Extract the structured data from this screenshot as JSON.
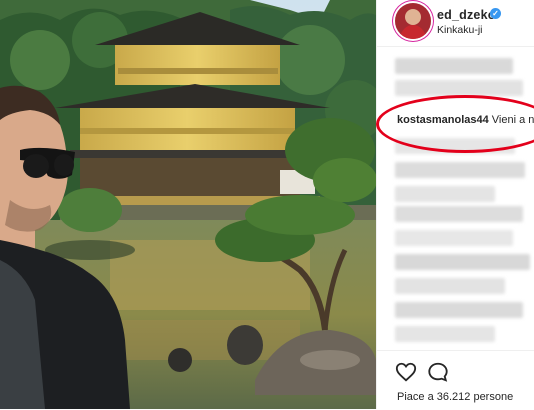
{
  "post": {
    "username": "ed_dzeko",
    "verified_icon": "verified-badge-icon",
    "location": "Kinkaku-ji"
  },
  "highlighted_comment": {
    "author": "kostasmanolas44",
    "text": "Vieni a na"
  },
  "footer": {
    "like_icon": "heart-icon",
    "comment_icon": "comment-icon",
    "likes_text": "Piace a 36.212 persone"
  },
  "colors": {
    "highlight_circle": "#e3001b",
    "verified": "#3897f0",
    "text": "#262626"
  }
}
